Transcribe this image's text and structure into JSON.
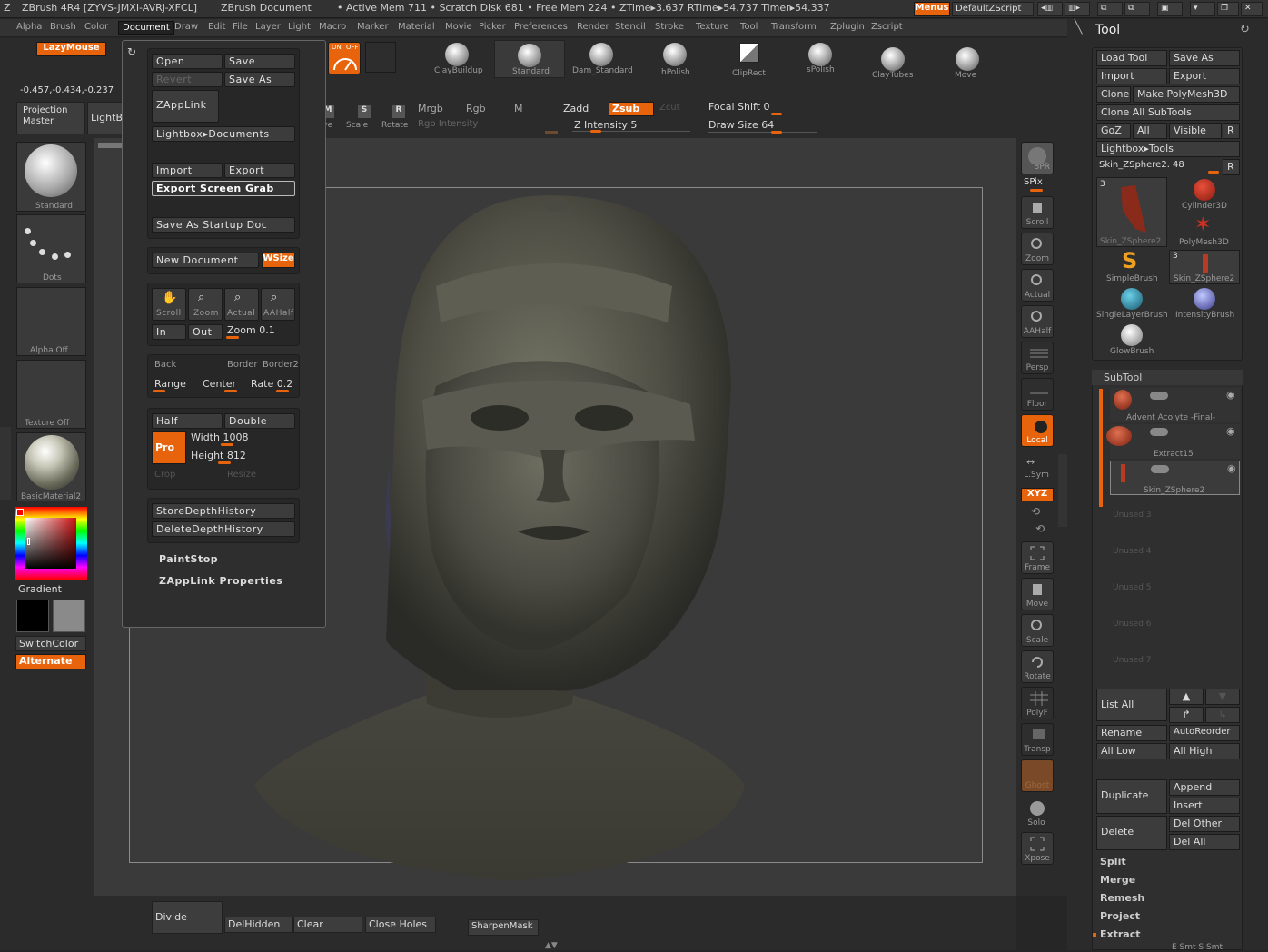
{
  "titlebar": {
    "app": "ZBrush 4R4 [ZYVS-JMXI-AVRJ-XFCL]",
    "doc": "ZBrush Document",
    "stats": "• Active Mem 711 • Scratch Disk 681 • Free Mem 224 • ZTime▸3.637 RTime▸54.737 Timer▸54.337",
    "menus_btn": "Menus",
    "script_btn": "DefaultZScript"
  },
  "menubar": [
    "Alpha",
    "Brush",
    "Color",
    "Document",
    "Draw",
    "Edit",
    "File",
    "Layer",
    "Light",
    "Macro",
    "Marker",
    "Material",
    "Movie",
    "Picker",
    "Preferences",
    "Render",
    "Stencil",
    "Stroke",
    "Texture",
    "Tool",
    "Transform",
    "Zplugin",
    "Zscript"
  ],
  "active_menu": "Document",
  "lazymouse": "LazyMouse",
  "coords": "-0.457,-0.434,-0.237",
  "projection_master": "Projection Master",
  "lightbox": "LightBox",
  "left_shelf": {
    "brush_label": "Standard",
    "stroke_label": "Dots",
    "alpha_label": "Alpha  Off",
    "texture_label": "Texture  Off",
    "material_label": "BasicMaterial2",
    "gradient": "Gradient",
    "switchcolor": "SwitchColor",
    "alternate": "Alternate"
  },
  "doc_menu": {
    "open": "Open",
    "save": "Save",
    "revert": "Revert",
    "save_as": "Save As",
    "zapplink": "ZAppLink",
    "lightbox_docs": "Lightbox▸Documents",
    "import": "Import",
    "export": "Export",
    "export_grab": "Export Screen Grab",
    "startup": "Save As Startup Doc",
    "new_doc": "New Document",
    "wsize": "WSize",
    "scroll": "Scroll",
    "zoom": "Zoom",
    "actual": "Actual",
    "aahalf": "AAHalf",
    "in": "In",
    "out": "Out",
    "zoom_val": "Zoom 0.1",
    "back": "Back",
    "border": "Border",
    "border2": "Border2",
    "range": "Range",
    "center": "Center",
    "rate": "Rate 0.2",
    "half": "Half",
    "double": "Double",
    "pro": "Pro",
    "width": "Width 1008",
    "height": "Height 812",
    "crop": "Crop",
    "resize": "Resize",
    "store_depth": "StoreDepthHistory",
    "delete_depth": "DeleteDepthHistory",
    "paintstop": "PaintStop",
    "zapplink_props": "ZAppLink Properties"
  },
  "top_toolbar": {
    "on": "ON",
    "off": "OFF",
    "move": "Move",
    "scale": "Scale",
    "rotate": "Rotate",
    "mrgb": "Mrgb",
    "rgb": "Rgb",
    "m": "M",
    "rgb_intensity": "Rgb  Intensity",
    "zadd": "Zadd",
    "zsub": "Zsub",
    "zcut": "Zcut",
    "z_intensity": "Z  Intensity 5",
    "focal_shift": "Focal  Shift 0",
    "draw_size": "Draw  Size 64",
    "brushes": [
      "ClayBuildup",
      "Standard",
      "Dam_Standard",
      "hPolish",
      "ClipRect",
      "sPolish",
      "ClayTubes",
      "Move"
    ]
  },
  "right_shelf": [
    "BPR",
    "SPix",
    "Scroll",
    "Zoom",
    "Actual",
    "AAHalf",
    "Persp",
    "Floor",
    "Local",
    "L.Sym",
    "XYZ",
    "Frame",
    "Move",
    "Scale",
    "Rotate",
    "PolyF",
    "Transp",
    "Ghost",
    "Solo",
    "Xpose"
  ],
  "tool_panel": {
    "title": "Tool",
    "load_tool": "Load Tool",
    "save_as": "Save As",
    "import": "Import",
    "export": "Export",
    "clone": "Clone",
    "make_polymesh": "Make PolyMesh3D",
    "clone_all": "Clone  All  SubTools",
    "goz": "GoZ",
    "all": "All",
    "visible": "Visible",
    "r": "R",
    "lightbox_tools": "Lightbox▸Tools",
    "current_tool": "Skin_ZSphere2. 48",
    "tools": [
      {
        "name": "Skin_ZSphere2",
        "count": "3"
      },
      {
        "name": "Cylinder3D",
        "count": ""
      },
      {
        "name": "PolyMesh3D",
        "count": ""
      },
      {
        "name": "SimpleBrush",
        "count": ""
      },
      {
        "name": "Skin_ZSphere2",
        "count": "3"
      },
      {
        "name": "SingleLayerBrush",
        "count": ""
      },
      {
        "name": "IntensityBrush",
        "count": ""
      },
      {
        "name": "GlowBrush",
        "count": ""
      }
    ]
  },
  "subtool": {
    "title": "SubTool",
    "items": [
      "Advent  Acolyte  -Final-",
      "Extract15",
      "Skin_ZSphere2"
    ],
    "unused": [
      "Unused  3",
      "Unused  4",
      "Unused  5",
      "Unused  6",
      "Unused  7"
    ],
    "list_all": "List  All",
    "rename": "Rename",
    "autoreorder": "AutoReorder",
    "all_low": "All  Low",
    "all_high": "All  High",
    "duplicate": "Duplicate",
    "append": "Append",
    "insert": "Insert",
    "delete": "Delete",
    "del_other": "Del  Other",
    "del_all": "Del  All",
    "split": "Split",
    "merge": "Merge",
    "remesh": "Remesh",
    "project": "Project",
    "extract": "Extract",
    "e_smt": "E  Smt  S  Smt"
  },
  "bottom_bar": {
    "divide": "Divide",
    "delhidden": "DelHidden",
    "clear": "Clear",
    "close_holes": "Close  Holes",
    "sharpenmask": "SharpenMask"
  },
  "colors": {
    "accent": "#e8640c",
    "panel": "#2f2f2f",
    "canvas": "#3a3a3a"
  }
}
